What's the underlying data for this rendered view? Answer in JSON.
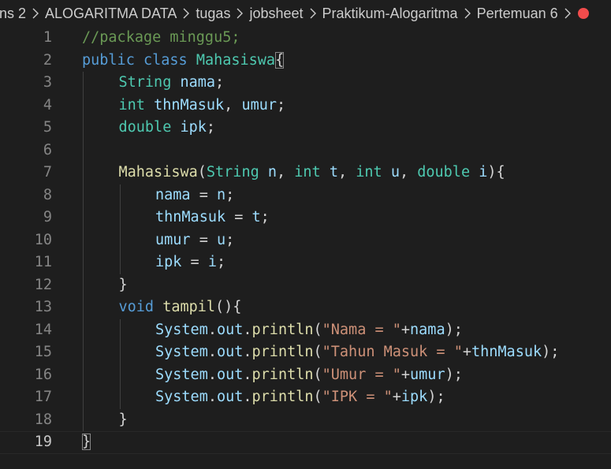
{
  "breadcrumb": {
    "items": [
      "ns 2",
      "ALOGARITMA DATA",
      "tugas",
      "jobsheet",
      "Praktikum-Alogaritma",
      "Pertemuan 6"
    ],
    "trailing_icon": "error-dot-icon",
    "separator_icon": "chevron-right-icon"
  },
  "editor": {
    "current_line": 19,
    "lines": [
      {
        "number": "1",
        "indent": 0,
        "tokens": [
          {
            "t": "//package minggu5;",
            "c": "comment"
          }
        ]
      },
      {
        "number": "2",
        "indent": 0,
        "tokens": [
          {
            "t": "public",
            "c": "keyword"
          },
          {
            "t": " ",
            "c": "punct"
          },
          {
            "t": "class",
            "c": "keyword"
          },
          {
            "t": " ",
            "c": "punct"
          },
          {
            "t": "Mahasiswa",
            "c": "type"
          },
          {
            "t": "{",
            "c": "bracket-match"
          }
        ]
      },
      {
        "number": "3",
        "indent": 1,
        "tokens": [
          {
            "t": "String",
            "c": "type"
          },
          {
            "t": " ",
            "c": "punct"
          },
          {
            "t": "nama",
            "c": "var"
          },
          {
            "t": ";",
            "c": "punct"
          }
        ]
      },
      {
        "number": "4",
        "indent": 1,
        "tokens": [
          {
            "t": "int",
            "c": "type"
          },
          {
            "t": " ",
            "c": "punct"
          },
          {
            "t": "thnMasuk",
            "c": "var"
          },
          {
            "t": ", ",
            "c": "punct"
          },
          {
            "t": "umur",
            "c": "var"
          },
          {
            "t": ";",
            "c": "punct"
          }
        ]
      },
      {
        "number": "5",
        "indent": 1,
        "tokens": [
          {
            "t": "double",
            "c": "type"
          },
          {
            "t": " ",
            "c": "punct"
          },
          {
            "t": "ipk",
            "c": "var"
          },
          {
            "t": ";",
            "c": "punct"
          }
        ]
      },
      {
        "number": "6",
        "indent": 1,
        "tokens": []
      },
      {
        "number": "7",
        "indent": 1,
        "tokens": [
          {
            "t": "Mahasiswa",
            "c": "fn"
          },
          {
            "t": "(",
            "c": "punct"
          },
          {
            "t": "String",
            "c": "type"
          },
          {
            "t": " ",
            "c": "punct"
          },
          {
            "t": "n",
            "c": "var"
          },
          {
            "t": ", ",
            "c": "punct"
          },
          {
            "t": "int",
            "c": "type"
          },
          {
            "t": " ",
            "c": "punct"
          },
          {
            "t": "t",
            "c": "var"
          },
          {
            "t": ", ",
            "c": "punct"
          },
          {
            "t": "int",
            "c": "type"
          },
          {
            "t": " ",
            "c": "punct"
          },
          {
            "t": "u",
            "c": "var"
          },
          {
            "t": ", ",
            "c": "punct"
          },
          {
            "t": "double",
            "c": "type"
          },
          {
            "t": " ",
            "c": "punct"
          },
          {
            "t": "i",
            "c": "var"
          },
          {
            "t": "){",
            "c": "punct"
          }
        ]
      },
      {
        "number": "8",
        "indent": 2,
        "tokens": [
          {
            "t": "nama",
            "c": "var"
          },
          {
            "t": " = ",
            "c": "punct"
          },
          {
            "t": "n",
            "c": "var"
          },
          {
            "t": ";",
            "c": "punct"
          }
        ]
      },
      {
        "number": "9",
        "indent": 2,
        "tokens": [
          {
            "t": "thnMasuk",
            "c": "var"
          },
          {
            "t": " = ",
            "c": "punct"
          },
          {
            "t": "t",
            "c": "var"
          },
          {
            "t": ";",
            "c": "punct"
          }
        ]
      },
      {
        "number": "10",
        "indent": 2,
        "tokens": [
          {
            "t": "umur",
            "c": "var"
          },
          {
            "t": " = ",
            "c": "punct"
          },
          {
            "t": "u",
            "c": "var"
          },
          {
            "t": ";",
            "c": "punct"
          }
        ]
      },
      {
        "number": "11",
        "indent": 2,
        "tokens": [
          {
            "t": "ipk",
            "c": "var"
          },
          {
            "t": " = ",
            "c": "punct"
          },
          {
            "t": "i",
            "c": "var"
          },
          {
            "t": ";",
            "c": "punct"
          }
        ]
      },
      {
        "number": "12",
        "indent": 1,
        "tokens": [
          {
            "t": "}",
            "c": "punct"
          }
        ]
      },
      {
        "number": "13",
        "indent": 1,
        "tokens": [
          {
            "t": "void",
            "c": "keyword"
          },
          {
            "t": " ",
            "c": "punct"
          },
          {
            "t": "tampil",
            "c": "fn"
          },
          {
            "t": "(){",
            "c": "punct"
          }
        ]
      },
      {
        "number": "14",
        "indent": 2,
        "tokens": [
          {
            "t": "System",
            "c": "var"
          },
          {
            "t": ".",
            "c": "punct"
          },
          {
            "t": "out",
            "c": "var"
          },
          {
            "t": ".",
            "c": "punct"
          },
          {
            "t": "println",
            "c": "fn"
          },
          {
            "t": "(",
            "c": "punct"
          },
          {
            "t": "\"Nama = \"",
            "c": "str"
          },
          {
            "t": "+",
            "c": "punct"
          },
          {
            "t": "nama",
            "c": "var"
          },
          {
            "t": ");",
            "c": "punct"
          }
        ]
      },
      {
        "number": "15",
        "indent": 2,
        "tokens": [
          {
            "t": "System",
            "c": "var"
          },
          {
            "t": ".",
            "c": "punct"
          },
          {
            "t": "out",
            "c": "var"
          },
          {
            "t": ".",
            "c": "punct"
          },
          {
            "t": "println",
            "c": "fn"
          },
          {
            "t": "(",
            "c": "punct"
          },
          {
            "t": "\"Tahun Masuk = \"",
            "c": "str"
          },
          {
            "t": "+",
            "c": "punct"
          },
          {
            "t": "thnMasuk",
            "c": "var"
          },
          {
            "t": ");",
            "c": "punct"
          }
        ]
      },
      {
        "number": "16",
        "indent": 2,
        "tokens": [
          {
            "t": "System",
            "c": "var"
          },
          {
            "t": ".",
            "c": "punct"
          },
          {
            "t": "out",
            "c": "var"
          },
          {
            "t": ".",
            "c": "punct"
          },
          {
            "t": "println",
            "c": "fn"
          },
          {
            "t": "(",
            "c": "punct"
          },
          {
            "t": "\"Umur = \"",
            "c": "str"
          },
          {
            "t": "+",
            "c": "punct"
          },
          {
            "t": "umur",
            "c": "var"
          },
          {
            "t": ");",
            "c": "punct"
          }
        ]
      },
      {
        "number": "17",
        "indent": 2,
        "tokens": [
          {
            "t": "System",
            "c": "var"
          },
          {
            "t": ".",
            "c": "punct"
          },
          {
            "t": "out",
            "c": "var"
          },
          {
            "t": ".",
            "c": "punct"
          },
          {
            "t": "println",
            "c": "fn"
          },
          {
            "t": "(",
            "c": "punct"
          },
          {
            "t": "\"IPK = \"",
            "c": "str"
          },
          {
            "t": "+",
            "c": "punct"
          },
          {
            "t": "ipk",
            "c": "var"
          },
          {
            "t": ");",
            "c": "punct"
          }
        ]
      },
      {
        "number": "18",
        "indent": 1,
        "tokens": [
          {
            "t": "}",
            "c": "punct"
          }
        ]
      },
      {
        "number": "19",
        "indent": 0,
        "tokens": [
          {
            "t": "}",
            "c": "bracket-match"
          }
        ]
      }
    ]
  },
  "colors": {
    "background": "#1e1e1e",
    "comment": "#6a9955",
    "keyword": "#569cd6",
    "type": "#4ec9b0",
    "variable": "#9cdcfe",
    "function": "#dcdcaa",
    "string": "#ce9178",
    "error_dot": "#f14c4c"
  }
}
